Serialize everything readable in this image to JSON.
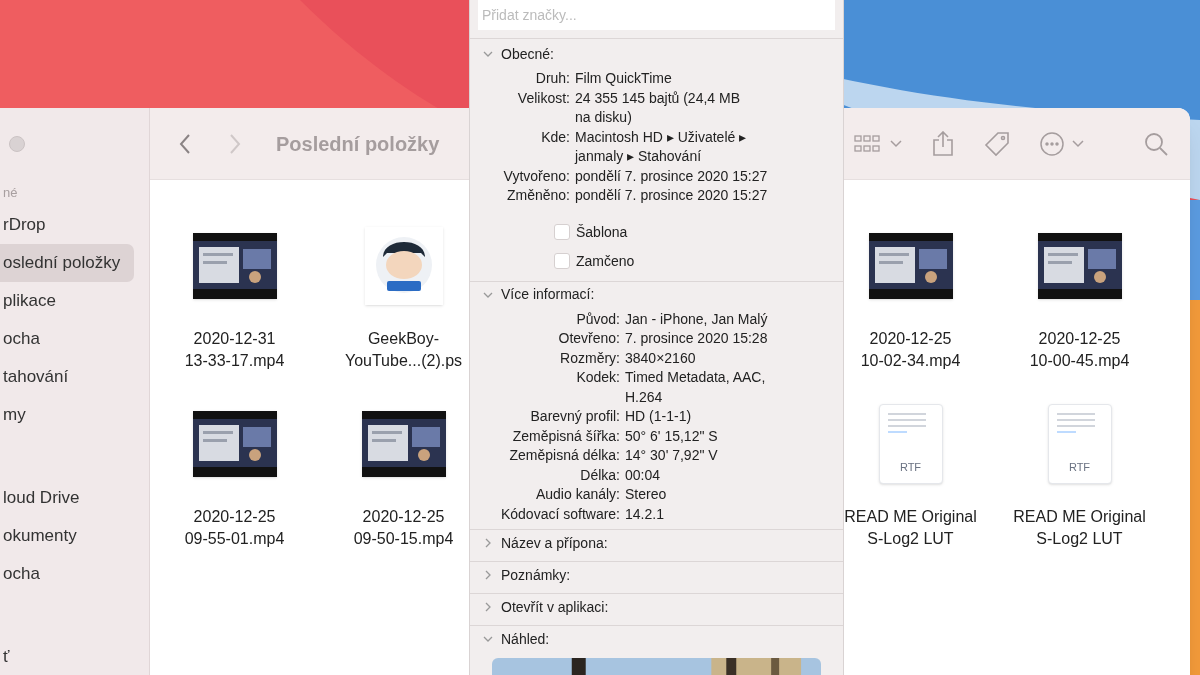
{
  "window": {
    "title": "Poslední položky",
    "back_enabled": true,
    "forward_enabled": false
  },
  "sidebar": {
    "items": [
      {
        "label": "né",
        "kind": "header",
        "selected": false
      },
      {
        "label": "rDrop",
        "kind": "item",
        "selected": false
      },
      {
        "label": "oslední položky",
        "kind": "item",
        "selected": true
      },
      {
        "label": "plikace",
        "kind": "item",
        "selected": false
      },
      {
        "label": "ocha",
        "kind": "item",
        "selected": false
      },
      {
        "label": "tahování",
        "kind": "item",
        "selected": false
      },
      {
        "label": "my",
        "kind": "item",
        "selected": false
      },
      {
        "label": "loud Drive",
        "kind": "item",
        "selected": false
      },
      {
        "label": "okumenty",
        "kind": "item",
        "selected": false
      },
      {
        "label": "ocha",
        "kind": "item",
        "selected": false
      },
      {
        "label": "ť",
        "kind": "item",
        "selected": false
      }
    ]
  },
  "files_left": [
    {
      "name": "2020-12-31\n13-33-17.mp4",
      "kind": "video"
    },
    {
      "name": "GeekBoy-\nYouTube...(2).ps"
    },
    {
      "name": "2020-12-25\n09-55-01.mp4",
      "kind": "video"
    },
    {
      "name": "2020-12-25\n09-50-15.mp4",
      "kind": "video"
    }
  ],
  "files_right": [
    {
      "name": "2020-12-25\n10-02-34.mp4",
      "kind": "video"
    },
    {
      "name": "2020-12-25\n10-00-45.mp4",
      "kind": "video"
    },
    {
      "name": "READ ME Original\nS-Log2 LUT",
      "kind": "document",
      "icon_label": "RTF"
    },
    {
      "name": "READ ME Original\nS-Log2 LUT",
      "kind": "document",
      "icon_label": "RTF"
    }
  ],
  "info": {
    "tags": {
      "placeholder": "Přidat značky..."
    },
    "sections": [
      {
        "title": "Obecné:",
        "expanded": true,
        "kind": "general",
        "rows": [
          {
            "label": "Druh:",
            "value": "Film QuickTime"
          },
          {
            "label": "Velikost:",
            "value": "24 355 145 bajtů (24,4 MB\nna disku)"
          },
          {
            "label": "Kde:",
            "value": "Macintosh HD ▸ Uživatelé ▸\njanmaly ▸ Stahování"
          },
          {
            "label": "Vytvořeno:",
            "value": "pondělí 7. prosince 2020 15:27"
          },
          {
            "label": "Změněno:",
            "value": "pondělí 7. prosince 2020 15:27"
          }
        ],
        "checkboxes": [
          {
            "label": "Šablona",
            "checked": false
          },
          {
            "label": "Zamčeno",
            "checked": false
          }
        ]
      },
      {
        "title": "Více informací:",
        "expanded": true,
        "kind": "details",
        "rows": [
          {
            "label": "Původ:",
            "value": "Jan - iPhone, Jan Malý"
          },
          {
            "label": "Otevřeno:",
            "value": "7. prosince 2020 15:28"
          },
          {
            "label": "Rozměry:",
            "value": "3840×2160"
          },
          {
            "label": "Kodek:",
            "value": "Timed Metadata, AAC,\nH.264"
          },
          {
            "label": "Barevný profil:",
            "value": "HD (1-1-1)"
          },
          {
            "label": "Zeměpisná šířka:",
            "value": "50° 6' 15,12\" S"
          },
          {
            "label": "Zeměpisná délka:",
            "value": "14° 30' 7,92\" V"
          },
          {
            "label": "Délka:",
            "value": "00:04"
          },
          {
            "label": "Audio kanály:",
            "value": "Stereo"
          },
          {
            "label": "Kódovací software:",
            "value": "14.2.1"
          }
        ]
      },
      {
        "title": "Název a přípona:",
        "expanded": false,
        "kind": "plain"
      },
      {
        "title": "Poznámky:",
        "expanded": false,
        "kind": "plain"
      },
      {
        "title": "Otevřít v aplikaci:",
        "expanded": false,
        "kind": "plain"
      },
      {
        "title": "Náhled:",
        "expanded": true,
        "kind": "preview"
      }
    ]
  }
}
